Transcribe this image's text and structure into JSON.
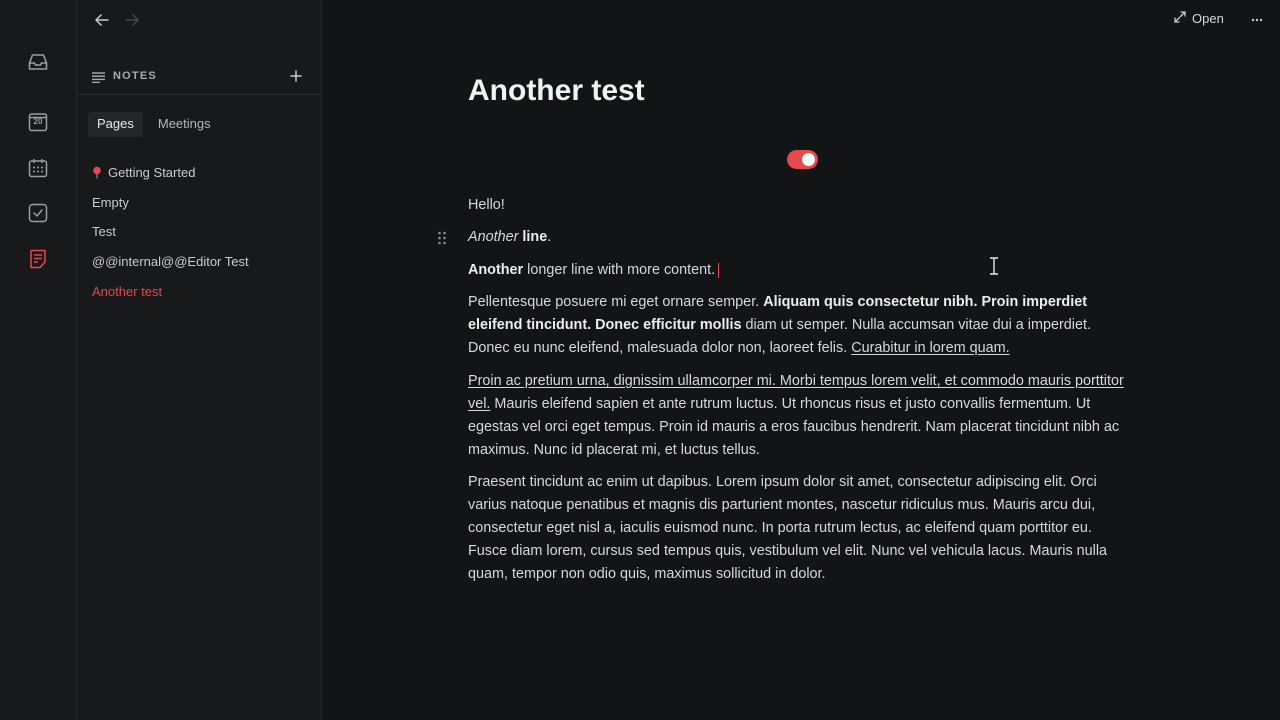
{
  "rail": {
    "items": [
      {
        "name": "inbox-icon"
      },
      {
        "name": "calendar-day-icon",
        "label": "20"
      },
      {
        "name": "calendar-icon"
      },
      {
        "name": "tasks-icon"
      },
      {
        "name": "notes-icon",
        "active": true
      }
    ],
    "accent": "#e5484d"
  },
  "sidebar": {
    "section_title": "NOTES",
    "tabs": [
      {
        "label": "Pages",
        "active": true
      },
      {
        "label": "Meetings",
        "active": false
      }
    ],
    "pages": [
      {
        "label": "Getting Started",
        "pinned": true
      },
      {
        "label": "Empty"
      },
      {
        "label": "Test"
      },
      {
        "label": "@@internal@@Editor Test"
      },
      {
        "label": "Another test",
        "active": true
      }
    ]
  },
  "topbar": {
    "open_label": "Open"
  },
  "document": {
    "title": "Another test",
    "toggle_on": true,
    "p1": "Hello!",
    "p2_italic": "Another",
    "p2_bold": "line",
    "p2_end": ".",
    "p3_bold": "Another",
    "p3_rest": " longer line with more content.",
    "p4_a": "Pellentesque posuere mi eget ornare semper. ",
    "p4_b": "Aliquam quis consectetur nibh. Proin imperdiet eleifend tincidunt. Donec efficitur mollis",
    "p4_c": " diam ut semper. Nulla accumsan vitae dui a imperdiet. Donec eu nunc eleifend, malesuada dolor non, laoreet felis. ",
    "p4_u": "Curabitur in lorem quam.",
    "p5_u": "Proin ac pretium urna, dignissim ullamcorper mi. Morbi tempus lorem velit, et commodo mauris porttitor vel.",
    "p5_rest": " Mauris eleifend sapien et ante rutrum luctus. Ut rhoncus risus et justo convallis fermentum. Ut egestas vel orci eget tempus. Proin id mauris a eros faucibus hendrerit. Nam placerat tincidunt nibh ac maximus. Nunc id placerat mi, et luctus tellus.",
    "p6": "Praesent tincidunt ac enim ut dapibus. Lorem ipsum dolor sit amet, consectetur adipiscing elit. Orci varius natoque penatibus et magnis dis parturient montes, nascetur ridiculus mus. Mauris arcu dui, consectetur eget nisl a, iaculis euismod nunc. In porta rutrum lectus, ac eleifend quam porttitor eu. Fusce diam lorem, cursus sed tempus quis, vestibulum vel elit. Nunc vel vehicula lacus. Mauris nulla quam, tempor non odio quis, maximus sollicitud in dolor."
  }
}
